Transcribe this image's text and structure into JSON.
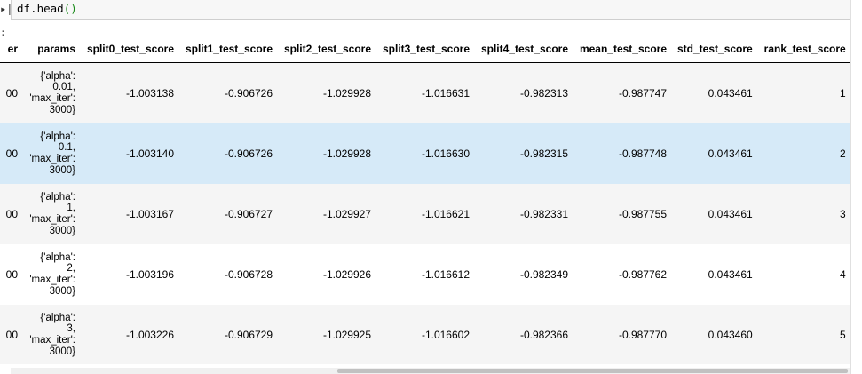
{
  "notebook": {
    "prompt_marker": "▸|",
    "code_prefix": "df.head",
    "code_parens": "()",
    "output_marker": ":"
  },
  "dataframe": {
    "columns": [
      "er",
      "params",
      "split0_test_score",
      "split1_test_score",
      "split2_test_score",
      "split3_test_score",
      "split4_test_score",
      "mean_test_score",
      "std_test_score",
      "rank_test_score"
    ],
    "rows": [
      {
        "iter": "00",
        "params": [
          "{'alpha':",
          "0.01,",
          "'max_iter':",
          "3000}"
        ],
        "split0": "-1.003138",
        "split1": "-0.906726",
        "split2": "-1.029928",
        "split3": "-1.016631",
        "split4": "-0.982313",
        "mean": "-0.987747",
        "std": "0.043461",
        "rank": "1"
      },
      {
        "iter": "00",
        "params": [
          "{'alpha':",
          "0.1,",
          "'max_iter':",
          "3000}"
        ],
        "split0": "-1.003140",
        "split1": "-0.906726",
        "split2": "-1.029928",
        "split3": "-1.016630",
        "split4": "-0.982315",
        "mean": "-0.987748",
        "std": "0.043461",
        "rank": "2"
      },
      {
        "iter": "00",
        "params": [
          "{'alpha':",
          "1,",
          "'max_iter':",
          "3000}"
        ],
        "split0": "-1.003167",
        "split1": "-0.906727",
        "split2": "-1.029927",
        "split3": "-1.016621",
        "split4": "-0.982331",
        "mean": "-0.987755",
        "std": "0.043461",
        "rank": "3"
      },
      {
        "iter": "00",
        "params": [
          "{'alpha':",
          "2,",
          "'max_iter':",
          "3000}"
        ],
        "split0": "-1.003196",
        "split1": "-0.906728",
        "split2": "-1.029926",
        "split3": "-1.016612",
        "split4": "-0.982349",
        "mean": "-0.987762",
        "std": "0.043461",
        "rank": "4"
      },
      {
        "iter": "00",
        "params": [
          "{'alpha':",
          "3,",
          "'max_iter':",
          "3000}"
        ],
        "split0": "-1.003226",
        "split1": "-0.906729",
        "split2": "-1.029925",
        "split3": "-1.016602",
        "split4": "-0.982366",
        "mean": "-0.987770",
        "std": "0.043460",
        "rank": "5"
      }
    ],
    "hovered_row": 1
  },
  "colors": {
    "row_odd": "#f5f5f5",
    "row_even": "#ffffff",
    "row_hover": "#d6eaf8"
  }
}
